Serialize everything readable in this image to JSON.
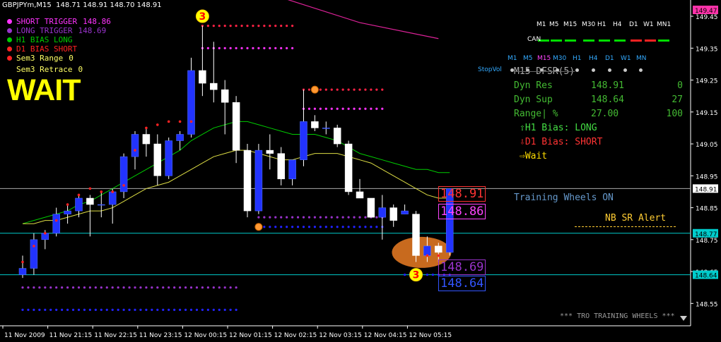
{
  "window": {
    "title": "GBPJPYm,M15  148.71 148.91 148.70 148.91"
  },
  "legend": [
    {
      "label": "SHORT TRIGGER",
      "value": "148.86",
      "color": "#ff33ff",
      "dot": "#ff33ff"
    },
    {
      "label": "LONG TRIGGER",
      "value": "148.69",
      "color": "#9933cc",
      "dot": "#9933cc"
    },
    {
      "label": "H1 BIAS LONG",
      "value": "",
      "color": "#00cc00",
      "dot": "#00cc00"
    },
    {
      "label": "D1 BIAS SHORT",
      "value": "",
      "color": "#ff2222",
      "dot": "#ff2222"
    },
    {
      "label": "Sem3 Range",
      "value": "0",
      "color": "#ffff66",
      "dot": "#ff2222"
    },
    {
      "label": "Sem3 Retrace",
      "value": "0",
      "color": "#ffff66",
      "dot": ""
    }
  ],
  "status_big": "WAIT",
  "timeframes": {
    "can_label": "CAN",
    "can_labels": [
      "M1",
      "M5",
      "M15",
      "M30",
      "H1",
      "H4",
      "D1",
      "W1",
      "MN1"
    ],
    "can_colors": [
      "#00dd00",
      "#00dd00",
      "#00dd00",
      "#00dd00",
      "#00dd00",
      "#00dd00",
      "#ff2222",
      "#ff2222",
      "#00dd00"
    ],
    "row2_labels": [
      "M1",
      "M5",
      "M15",
      "M30",
      "H1",
      "H4",
      "D1",
      "W1",
      "MN"
    ],
    "row2_label_colors": [
      "#33aaff",
      "#33aaff",
      "#ff44ff",
      "#33aaff",
      "#33aaff",
      "#33aaff",
      "#33aaff",
      "#33aaff",
      "#33aaff"
    ],
    "stopvol": "StopVol"
  },
  "dfsr": {
    "title": "M15 DFSR(5)",
    "rows": [
      {
        "label": "Dyn Res",
        "value": "148.91",
        "extra": "0"
      },
      {
        "label": "Dyn Sup",
        "value": "148.64",
        "extra": "27"
      },
      {
        "label": "Range| %",
        "value": "27.00",
        "extra": "100"
      }
    ],
    "h1_bias": "H1 Bias: LONG",
    "d1_bias": "D1 Bias: SHORT",
    "wait": "Wait"
  },
  "training_wheels_on": "Training Wheels ON",
  "nb_sr_alert": "NB SR Alert",
  "footer": "*** TRO TRAINING WHEELS ***",
  "price_labels": {
    "res": "148.91",
    "short_trigger": "148.86",
    "long_trigger": "148.69",
    "sup": "148.64"
  },
  "axis_right_tags": [
    {
      "price": 149.47,
      "label": "149.47",
      "bg": "#ff33aa",
      "fg": "#000"
    },
    {
      "price": 148.91,
      "label": "148.91",
      "bg": "#ffffff",
      "fg": "#000"
    },
    {
      "price": 148.77,
      "label": "148.77",
      "bg": "#00cccc",
      "fg": "#000"
    },
    {
      "price": 148.64,
      "label": "148.64",
      "bg": "#00cccc",
      "fg": "#000"
    }
  ],
  "chart_data": {
    "type": "candlestick",
    "title": "GBPJPYm,M15",
    "ylim": [
      148.48,
      149.47
    ],
    "y_ticks": [
      149.45,
      149.35,
      149.25,
      149.15,
      149.05,
      148.95,
      148.85,
      148.75,
      148.65,
      148.55
    ],
    "y_tick_labels": [
      "149.45",
      "149.35",
      "149.25",
      "149.15",
      "149.05",
      "148.95",
      "148.85",
      "148.75",
      "148.65",
      "148.55"
    ],
    "x_tick_labels": [
      "11 Nov 2009",
      "11 Nov 21:15",
      "11 Nov 22:15",
      "11 Nov 23:15",
      "12 Nov 00:15",
      "12 Nov 01:15",
      "12 Nov 02:15",
      "12 Nov 03:15",
      "12 Nov 04:15",
      "12 Nov 05:15"
    ],
    "x_tick_candle_index": [
      0,
      4,
      8,
      12,
      16,
      20,
      24,
      28,
      32,
      36
    ],
    "candles": [
      {
        "o": 148.64,
        "h": 148.7,
        "l": 148.63,
        "c": 148.66
      },
      {
        "o": 148.66,
        "h": 148.77,
        "l": 148.64,
        "c": 148.75
      },
      {
        "o": 148.75,
        "h": 148.78,
        "l": 148.72,
        "c": 148.77
      },
      {
        "o": 148.77,
        "h": 148.85,
        "l": 148.76,
        "c": 148.83
      },
      {
        "o": 148.83,
        "h": 148.86,
        "l": 148.8,
        "c": 148.84
      },
      {
        "o": 148.84,
        "h": 148.89,
        "l": 148.82,
        "c": 148.88
      },
      {
        "o": 148.88,
        "h": 148.89,
        "l": 148.76,
        "c": 148.86
      },
      {
        "o": 148.86,
        "h": 148.9,
        "l": 148.82,
        "c": 148.86
      },
      {
        "o": 148.86,
        "h": 148.91,
        "l": 148.8,
        "c": 148.9
      },
      {
        "o": 148.9,
        "h": 149.02,
        "l": 148.88,
        "c": 149.01
      },
      {
        "o": 149.01,
        "h": 149.09,
        "l": 148.97,
        "c": 149.08
      },
      {
        "o": 149.08,
        "h": 149.1,
        "l": 149.01,
        "c": 149.05
      },
      {
        "o": 149.05,
        "h": 149.08,
        "l": 148.92,
        "c": 148.95
      },
      {
        "o": 148.95,
        "h": 149.07,
        "l": 148.94,
        "c": 149.06
      },
      {
        "o": 149.06,
        "h": 149.09,
        "l": 149.03,
        "c": 149.08
      },
      {
        "o": 149.08,
        "h": 149.32,
        "l": 149.07,
        "c": 149.28
      },
      {
        "o": 149.28,
        "h": 149.42,
        "l": 149.2,
        "c": 149.24
      },
      {
        "o": 149.24,
        "h": 149.37,
        "l": 149.18,
        "c": 149.22
      },
      {
        "o": 149.22,
        "h": 149.25,
        "l": 149.08,
        "c": 149.18
      },
      {
        "o": 149.18,
        "h": 149.2,
        "l": 148.99,
        "c": 149.03
      },
      {
        "o": 149.03,
        "h": 149.05,
        "l": 148.82,
        "c": 148.84
      },
      {
        "o": 148.84,
        "h": 149.05,
        "l": 148.83,
        "c": 149.03
      },
      {
        "o": 149.03,
        "h": 149.08,
        "l": 148.97,
        "c": 149.02
      },
      {
        "o": 149.02,
        "h": 149.04,
        "l": 148.92,
        "c": 148.94
      },
      {
        "o": 148.94,
        "h": 149.0,
        "l": 148.92,
        "c": 149.0
      },
      {
        "o": 149.0,
        "h": 149.22,
        "l": 148.98,
        "c": 149.12
      },
      {
        "o": 149.12,
        "h": 149.14,
        "l": 149.09,
        "c": 149.1
      },
      {
        "o": 149.1,
        "h": 149.12,
        "l": 149.08,
        "c": 149.1
      },
      {
        "o": 149.1,
        "h": 149.11,
        "l": 149.04,
        "c": 149.05
      },
      {
        "o": 149.05,
        "h": 149.06,
        "l": 148.89,
        "c": 148.9
      },
      {
        "o": 148.9,
        "h": 148.94,
        "l": 148.88,
        "c": 148.88
      },
      {
        "o": 148.88,
        "h": 148.88,
        "l": 148.82,
        "c": 148.82
      },
      {
        "o": 148.82,
        "h": 148.89,
        "l": 148.75,
        "c": 148.85
      },
      {
        "o": 148.85,
        "h": 148.86,
        "l": 148.79,
        "c": 148.81
      },
      {
        "o": 148.83,
        "h": 148.86,
        "l": 148.83,
        "c": 148.84
      },
      {
        "o": 148.83,
        "h": 148.84,
        "l": 148.68,
        "c": 148.7
      },
      {
        "o": 148.7,
        "h": 148.76,
        "l": 148.68,
        "c": 148.73
      },
      {
        "o": 148.73,
        "h": 148.74,
        "l": 148.68,
        "c": 148.71
      },
      {
        "o": 148.71,
        "h": 148.91,
        "l": 148.7,
        "c": 148.91
      }
    ],
    "sma_fast": [
      148.8,
      148.81,
      148.82,
      148.83,
      148.84,
      148.86,
      148.87,
      148.89,
      148.91,
      148.93,
      148.95,
      148.97,
      148.99,
      149.01,
      149.03,
      149.06,
      149.08,
      149.1,
      149.11,
      149.12,
      149.12,
      149.11,
      149.1,
      149.09,
      149.08,
      149.08,
      149.08,
      149.07,
      149.06,
      149.04,
      149.02,
      149.01,
      149.0,
      148.99,
      148.98,
      148.97,
      148.97,
      148.96,
      148.96
    ],
    "sma_fast_color": "#00cc00",
    "sma_slow": [
      148.8,
      148.8,
      148.81,
      148.81,
      148.82,
      148.83,
      148.84,
      148.84,
      148.85,
      148.87,
      148.89,
      148.91,
      148.92,
      148.93,
      148.95,
      148.97,
      148.99,
      149.01,
      149.02,
      149.03,
      149.03,
      149.02,
      149.01,
      149.0,
      149.0,
      149.01,
      149.02,
      149.02,
      149.02,
      149.01,
      149.0,
      148.99,
      148.97,
      148.95,
      148.93,
      148.91,
      148.89,
      148.88,
      148.88
    ],
    "sma_slow_color": "#dddd44",
    "pink_line": [
      {
        "i": 15,
        "p": 149.56
      },
      {
        "i": 22,
        "p": 149.52
      },
      {
        "i": 30,
        "p": 149.43
      },
      {
        "i": 37,
        "p": 149.38
      }
    ],
    "pink_line_color": "#dd2299",
    "horizontal_lines": [
      {
        "price": 148.91,
        "color": "#aaaaaa"
      },
      {
        "price": 148.77,
        "color": "#00cccc"
      },
      {
        "price": 148.64,
        "color": "#00cccc"
      }
    ],
    "dot_rows": [
      {
        "from": 16,
        "to": 24,
        "price": 149.42,
        "color": "#ff2244"
      },
      {
        "from": 16,
        "to": 24,
        "price": 149.35,
        "color": "#ff33ff"
      },
      {
        "from": 25,
        "to": 32,
        "price": 149.22,
        "color": "#ff2244"
      },
      {
        "from": 25,
        "to": 32,
        "price": 149.16,
        "color": "#ff33ff"
      },
      {
        "from": 21,
        "to": 32,
        "price": 148.82,
        "color": "#9933cc"
      },
      {
        "from": 21,
        "to": 32,
        "price": 148.79,
        "color": "#2222ff"
      },
      {
        "from": 0,
        "to": 19,
        "price": 148.6,
        "color": "#9933cc"
      },
      {
        "from": 0,
        "to": 19,
        "price": 148.53,
        "color": "#2222ff"
      },
      {
        "from": 34,
        "to": 38,
        "price": 148.64,
        "color": "#2222ff"
      }
    ],
    "fractal_markers": [
      {
        "i": 16,
        "price": 149.45,
        "label": "3",
        "color": "#ffff00"
      },
      {
        "i": 21,
        "price": 148.79,
        "label": "",
        "color": "#ff9933"
      },
      {
        "i": 26,
        "price": 149.22,
        "label": "",
        "color": "#ff9933"
      },
      {
        "i": 35,
        "price": 148.64,
        "label": "3",
        "color": "#ffff00"
      }
    ],
    "ellipse": {
      "i_center": 35.5,
      "price": 148.71,
      "color": "#c86a1e"
    },
    "red_dots": [
      {
        "i": 0,
        "p": 148.68
      },
      {
        "i": 1,
        "p": 148.73
      },
      {
        "i": 2,
        "p": 148.77
      },
      {
        "i": 3,
        "p": 148.81
      },
      {
        "i": 4,
        "p": 148.86
      },
      {
        "i": 5,
        "p": 148.89
      },
      {
        "i": 6,
        "p": 148.91
      },
      {
        "i": 7,
        "p": 148.9
      },
      {
        "i": 8,
        "p": 148.9
      },
      {
        "i": 9,
        "p": 148.92
      },
      {
        "i": 10,
        "p": 149.03
      },
      {
        "i": 11,
        "p": 149.1
      },
      {
        "i": 12,
        "p": 149.11
      },
      {
        "i": 13,
        "p": 149.12
      },
      {
        "i": 14,
        "p": 149.12
      },
      {
        "i": 15,
        "p": 149.12
      },
      {
        "i": 36,
        "p": 148.7
      },
      {
        "i": 37,
        "p": 148.7
      }
    ]
  }
}
